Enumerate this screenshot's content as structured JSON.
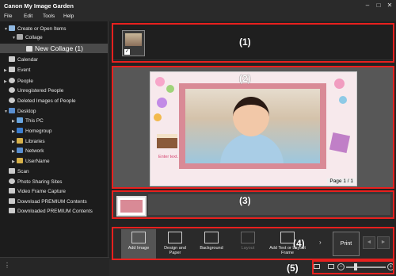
{
  "window": {
    "title": "Canon My Image Garden",
    "minimize": "–",
    "maximize": "□",
    "close": "✕"
  },
  "menu": [
    "File",
    "Edit",
    "Tools",
    "Help"
  ],
  "sidebar": {
    "items": [
      {
        "label": "Create or Open Items",
        "icon": "create-icon"
      },
      {
        "label": "Collage",
        "icon": "collage-icon"
      },
      {
        "label": "New Collage (1)",
        "icon": "collage-doc-icon"
      },
      {
        "label": "Calendar",
        "icon": "calendar-icon"
      },
      {
        "label": "Event",
        "icon": "event-icon"
      },
      {
        "label": "People",
        "icon": "people-icon"
      },
      {
        "label": "Unregistered People",
        "icon": "person-icon"
      },
      {
        "label": "Deleted Images of People",
        "icon": "person-icon"
      },
      {
        "label": "Desktop",
        "icon": "folder-icon"
      },
      {
        "label": "This PC",
        "icon": "pc-icon"
      },
      {
        "label": "Homegroup",
        "icon": "homegroup-icon"
      },
      {
        "label": "Libraries",
        "icon": "folder-icon"
      },
      {
        "label": "Network",
        "icon": "network-icon"
      },
      {
        "label": "UserName",
        "icon": "folder-icon"
      },
      {
        "label": "Scan",
        "icon": "scan-icon"
      },
      {
        "label": "Photo Sharing Sites",
        "icon": "globe-icon"
      },
      {
        "label": "Video Frame Capture",
        "icon": "video-icon"
      },
      {
        "label": "Download PREMIUM Contents",
        "icon": "download-icon"
      },
      {
        "label": "Downloaded PREMIUM Contents",
        "icon": "download-icon"
      }
    ]
  },
  "callouts": [
    "(1)",
    "(2)",
    "(3)",
    "(4)",
    "(5)"
  ],
  "edit_area": {
    "placeholder_text": "Enter text.",
    "page_indicator": "Page 1 / 1"
  },
  "toolbar": {
    "tools": [
      "Add Image",
      "Design and Paper",
      "Background",
      "Layout",
      "Add Text or Layout Frame"
    ],
    "print_label": "Print",
    "more_glyph": "›",
    "prev_glyph": "◄",
    "next_glyph": "►"
  },
  "statusbar": {
    "zoom_out": "−",
    "zoom_in": "+",
    "zoom_level": 0.2
  },
  "colors": {
    "callout": "#e8201e",
    "frame": "#d98a96",
    "background": "#1e1e1e"
  }
}
